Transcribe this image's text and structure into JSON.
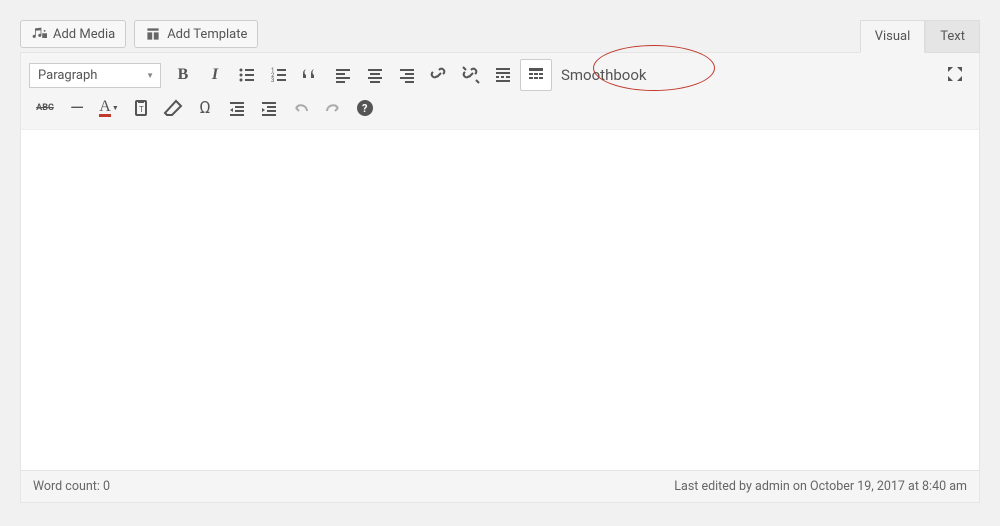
{
  "buttons": {
    "add_media": "Add Media",
    "add_template": "Add Template"
  },
  "tabs": {
    "visual": "Visual",
    "text": "Text"
  },
  "format_dropdown": "Paragraph",
  "custom_button": "Smoothbook",
  "status": {
    "word_count_label": "Word count: ",
    "word_count_value": "0",
    "last_edited": "Last edited by admin on October 19, 2017 at 8:40 am"
  }
}
